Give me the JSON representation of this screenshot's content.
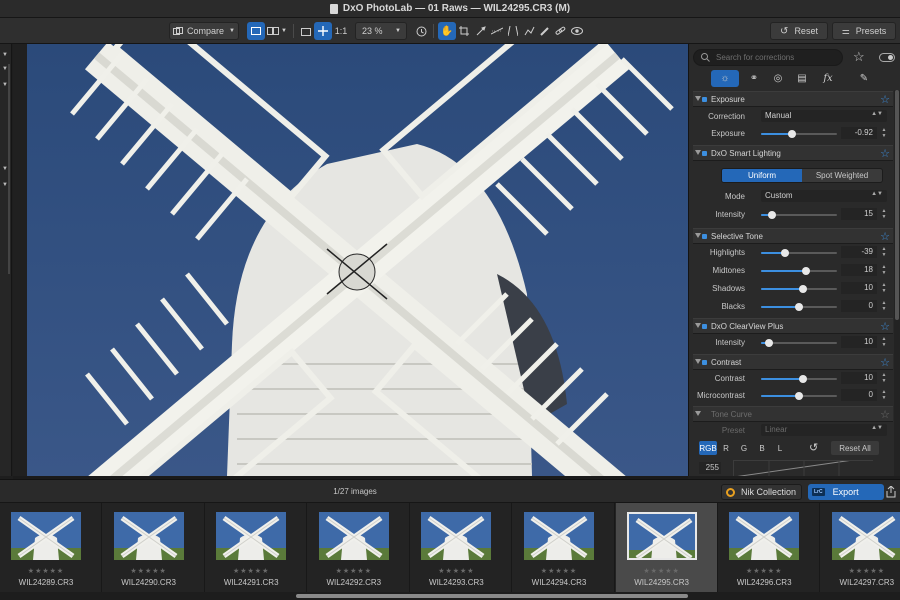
{
  "window": {
    "title": "DxO PhotoLab — 01 Raws — WIL24295.CR3 (M)"
  },
  "toolbar": {
    "compare_label": "Compare",
    "zoom_1to1": "1:1",
    "zoom_level": "23 %",
    "reset_label": "Reset",
    "presets_label": "Presets"
  },
  "panel": {
    "search_placeholder": "Search for corrections",
    "exposure": {
      "title": "Exposure",
      "correction_label": "Correction",
      "correction_value": "Manual",
      "exposure_label": "Exposure",
      "exposure_value": "-0.92",
      "exposure_level": 0.41
    },
    "smart_lighting": {
      "title": "DxO Smart Lighting",
      "uniform_label": "Uniform",
      "spot_label": "Spot Weighted",
      "mode_label": "Mode",
      "mode_value": "Custom",
      "intensity_label": "Intensity",
      "intensity_value": "15",
      "intensity_level": 0.15
    },
    "selective_tone": {
      "title": "Selective Tone",
      "rows": [
        {
          "label": "Highlights",
          "value": "-39",
          "level": 0.31
        },
        {
          "label": "Midtones",
          "value": "18",
          "level": 0.59
        },
        {
          "label": "Shadows",
          "value": "10",
          "level": 0.55
        },
        {
          "label": "Blacks",
          "value": "0",
          "level": 0.5
        }
      ]
    },
    "clearview": {
      "title": "DxO ClearView Plus",
      "intensity_label": "Intensity",
      "intensity_value": "10",
      "intensity_level": 0.1
    },
    "contrast": {
      "title": "Contrast",
      "contrast_label": "Contrast",
      "contrast_value": "10",
      "contrast_level": 0.55,
      "micro_label": "Microcontrast",
      "micro_value": "0",
      "micro_level": 0.5
    },
    "tone_curve": {
      "title": "Tone Curve",
      "preset_label": "Preset",
      "preset_value": "Linear",
      "channels": [
        "RGB",
        "R",
        "G",
        "B",
        "L"
      ],
      "reset_all_label": "Reset All",
      "value_255": "255"
    }
  },
  "filmstrip": {
    "count_label": "1/27 images",
    "nik_label": "Nik Collection",
    "export_label": "Export",
    "lrc_label": "LrC",
    "stars": "★★★★★",
    "thumbs": [
      "WIL24289.CR3",
      "WIL24290.CR3",
      "WIL24291.CR3",
      "WIL24292.CR3",
      "WIL24293.CR3",
      "WIL24294.CR3",
      "WIL24295.CR3",
      "WIL24296.CR3",
      "WIL24297.CR3"
    ],
    "selected_index": 6
  },
  "colors": {
    "accent": "#2468b8",
    "sky": "#2f4a78",
    "sail_white": "#ebebe6"
  }
}
